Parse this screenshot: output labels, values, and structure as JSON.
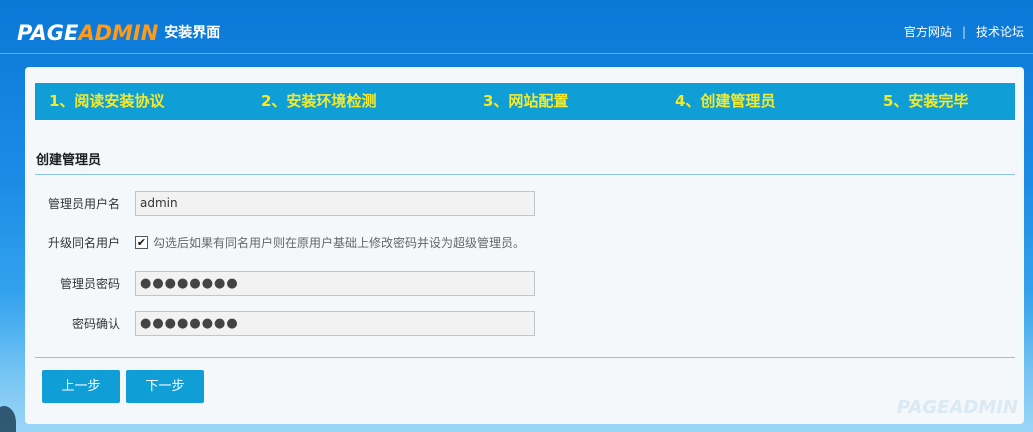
{
  "header": {
    "logo_page": "PAGE",
    "logo_admin": "ADMIN",
    "subtitle": "安装界面",
    "links": [
      "官方网站",
      "技术论坛"
    ],
    "separator": "|"
  },
  "steps": [
    "1、阅读安装协议",
    "2、安装环境检测",
    "3、网站配置",
    "4、创建管理员",
    "5、安装完毕"
  ],
  "form": {
    "section_title": "创建管理员",
    "username_label": "管理员用户名",
    "username_value": "admin",
    "upgrade_label": "升级同名用户",
    "upgrade_checked": true,
    "upgrade_hint": "勾选后如果有同名用户则在原用户基础上修改密码并设为超级管理员。",
    "password_label": "管理员密码",
    "password_value": "●●●●●●●●",
    "confirm_label": "密码确认",
    "confirm_value": "●●●●●●●●"
  },
  "buttons": {
    "prev": "上一步",
    "next": "下一步"
  },
  "watermark": "PAGEADMIN",
  "colors": {
    "accent": "#0f9ed6",
    "step_text": "#f5ea2a",
    "logo_admin": "#ff9a1a"
  }
}
